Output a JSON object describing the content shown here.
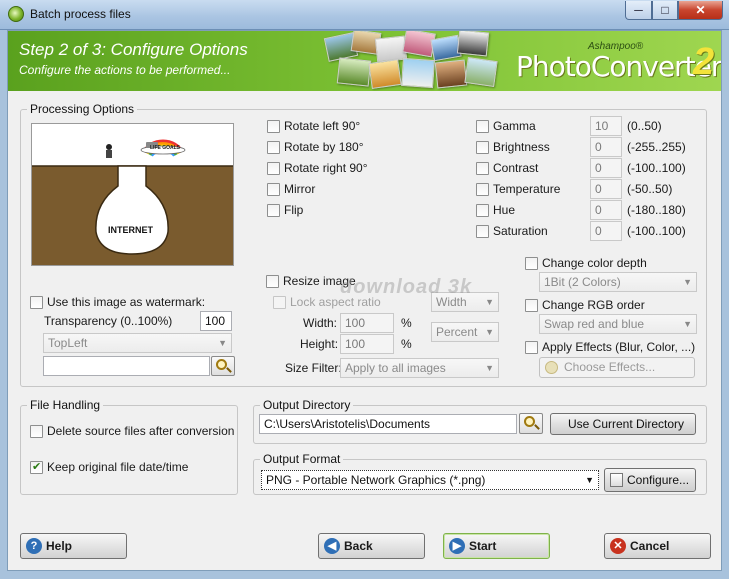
{
  "window": {
    "title": "Batch process files",
    "minimize": "─",
    "maximize": "□",
    "close": "✕"
  },
  "banner": {
    "step_title": "Step 2 of 3: Configure Options",
    "step_subtitle": "Configure the actions to be performed...",
    "logo_brand": "Ashampoo®",
    "logo_product": "PhotoConverter",
    "logo_version": "2"
  },
  "processing": {
    "legend": "Processing Options",
    "preview_caption": "INTERNET",
    "preview_sign": "LIFE GOALS",
    "transforms": [
      "Rotate left 90°",
      "Rotate by 180°",
      "Rotate right 90°",
      "Mirror",
      "Flip"
    ],
    "adjustments": [
      {
        "label": "Gamma",
        "value": "10",
        "range": "(0..50)"
      },
      {
        "label": "Brightness",
        "value": "0",
        "range": "(-255..255)"
      },
      {
        "label": "Contrast",
        "value": "0",
        "range": "(-100..100)"
      },
      {
        "label": "Temperature",
        "value": "0",
        "range": "(-50..50)"
      },
      {
        "label": "Hue",
        "value": "0",
        "range": "(-180..180)"
      },
      {
        "label": "Saturation",
        "value": "0",
        "range": "(-100..100)"
      }
    ],
    "watermark": {
      "label": "Use this image as watermark:",
      "transparency_label": "Transparency (0..100%)",
      "transparency_value": "100",
      "position": "TopLeft",
      "file_path": ""
    },
    "resize": {
      "label": "Resize image",
      "lock_label": "Lock aspect ratio",
      "lock_mode": "Width",
      "width_label": "Width:",
      "width_value": "100",
      "height_label": "Height:",
      "height_value": "100",
      "unit_symbol": "%",
      "unit_select": "Percent",
      "size_filter_label": "Size Filter:",
      "size_filter_value": "Apply to all images"
    },
    "color_depth": {
      "label": "Change color depth",
      "value": "1Bit (2 Colors)"
    },
    "rgb_order": {
      "label": "Change RGB order",
      "value": "Swap red and blue"
    },
    "effects": {
      "label": "Apply Effects (Blur, Color, ...)",
      "button": "Choose Effects..."
    }
  },
  "file_handling": {
    "legend": "File Handling",
    "delete_label": "Delete source files after conversion",
    "delete_checked": false,
    "keep_date_label": "Keep original file date/time",
    "keep_date_checked": true
  },
  "output_dir": {
    "legend": "Output Directory",
    "path": "C:\\Users\\Aristotelis\\Documents",
    "use_current_button": "Use Current Directory"
  },
  "output_format": {
    "legend": "Output Format",
    "value": "PNG - Portable Network Graphics (*.png)",
    "configure_button": "Configure..."
  },
  "footer": {
    "help": "Help",
    "back": "Back",
    "start": "Start",
    "cancel": "Cancel"
  },
  "site_watermark": "download 3k",
  "colors": {
    "banner_green": "#7fc335",
    "help_icon": "#2f6fb6",
    "back_icon": "#2f6fb6",
    "start_icon": "#2f6fb6",
    "cancel_icon": "#c8321e"
  }
}
